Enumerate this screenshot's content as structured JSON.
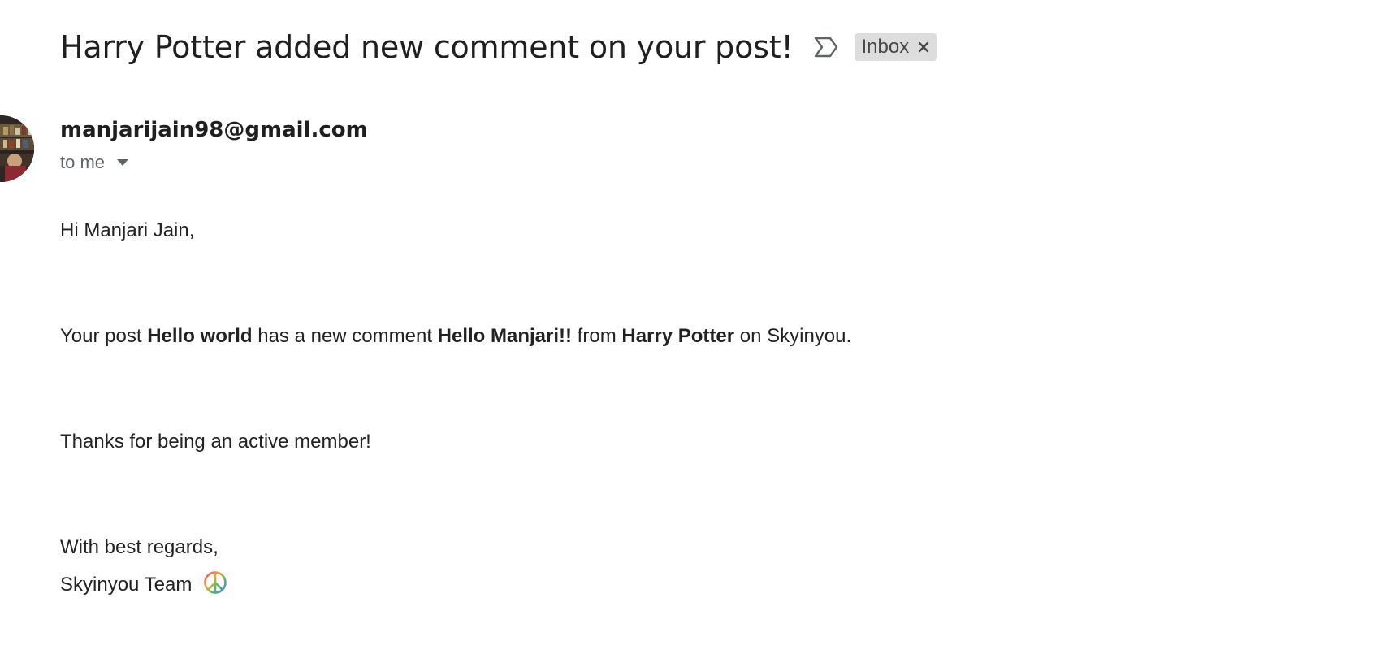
{
  "email": {
    "subject": "Harry Potter added new comment on your post!",
    "label": "Inbox",
    "sender": "manjarijain98@gmail.com",
    "recipient": "to me",
    "body": {
      "greeting": "Hi Manjari Jain,",
      "message": {
        "p1": "Your post ",
        "post_title": "Hello world",
        "p2": " has a new comment ",
        "comment": "Hello Manjari!!",
        "p3": " from ",
        "commenter": "Harry Potter",
        "p4": " on Skyinyou."
      },
      "thanks": "Thanks for being an active member!",
      "closing": "With best regards,",
      "signature": "Skyinyou Team"
    }
  },
  "icons": {
    "important": "important-marker-icon",
    "label_remove": "close-icon",
    "recipient_details": "chevron-down-icon",
    "signature_emoji": "peace-sign-icon"
  }
}
